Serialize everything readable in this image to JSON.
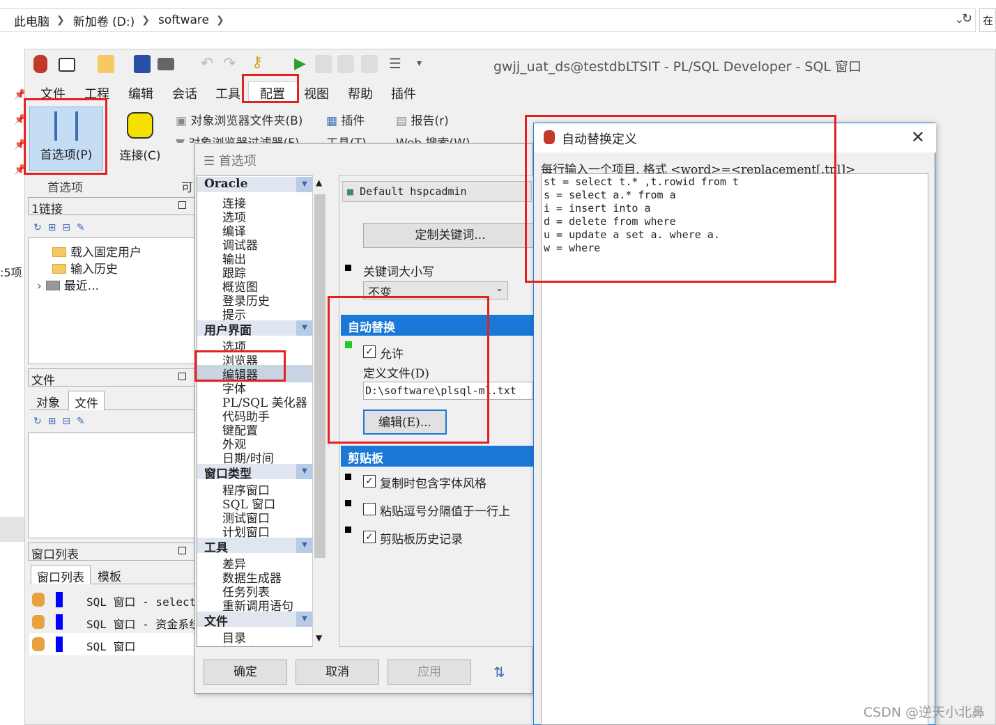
{
  "explorer": {
    "breadcrumb": [
      "此电脑",
      "新加卷 (D:)",
      "software"
    ],
    "side_label": "在",
    "left_label": ":5项"
  },
  "app": {
    "title": "gwjj_uat_ds@testdbLTSIT - PL/SQL Developer - SQL 窗口",
    "menu": [
      "文件",
      "工程",
      "编辑",
      "会话",
      "工具",
      "配置",
      "视图",
      "帮助",
      "插件"
    ],
    "active_menu": "配置",
    "ribbon": {
      "preferences": "首选项(P)",
      "connect": "连接(C)",
      "obj_browser_folders": "对象浏览器文件夹(B)",
      "obj_browser_filters": "对象浏览器过滤器(F)",
      "plugins": "插件",
      "reports": "报告(r)",
      "tools": "工具(T)",
      "web_search": "Web 搜索(W)",
      "group_prefs": "首选项",
      "group_other": "可"
    }
  },
  "left": {
    "conn_header": "1链接",
    "conn_items": [
      "载入固定用户",
      "输入历史",
      "最近..."
    ],
    "files_header": "文件",
    "files_tabs": [
      "对象",
      "文件"
    ],
    "winlist_header": "窗口列表",
    "winlist_tabs": [
      "窗口列表",
      "模板"
    ],
    "windows": [
      "SQL 窗口 - select",
      "SQL 窗口 - 资金系统",
      "SQL 窗口"
    ]
  },
  "prefs": {
    "title": "首选项",
    "nav": [
      {
        "group": "Oracle",
        "items": [
          "连接",
          "选项",
          "编译",
          "调试器",
          "输出",
          "跟踪",
          "概览图",
          "登录历史",
          "提示"
        ]
      },
      {
        "group": "用户界面",
        "items": [
          "选项",
          "浏览器",
          "编辑器",
          "字体",
          "PL/SQL 美化器",
          "代码助手",
          "键配置",
          "外观",
          "日期/时间"
        ]
      },
      {
        "group": "窗口类型",
        "items": [
          "程序窗口",
          "SQL 窗口",
          "测试窗口",
          "计划窗口"
        ]
      },
      {
        "group": "工具",
        "items": [
          "差异",
          "数据生成器",
          "任务列表",
          "重新调用语句"
        ]
      },
      {
        "group": "文件",
        "items": [
          "目录",
          "扩展名"
        ]
      }
    ],
    "selected_item": "编辑器",
    "profile": "Default hspcadmin",
    "define_keywords_btn": "定制关键词...",
    "keyword_case_label": "关键词大小写",
    "keyword_case_value": "不变",
    "autoreplace_header": "自动替换",
    "autoreplace_enabled_label": "允许",
    "autoreplace_enabled": true,
    "def_file_label": "定义文件(D)",
    "def_file_value": "D:\\software\\plsql-ml.txt",
    "edit_btn": "编辑(E)...",
    "clipboard_header": "剪贴板",
    "clip_opt1": "复制时包含字体风格",
    "clip_opt2": "粘贴逗号分隔值于一行上",
    "clip_opt3": "剪贴板历史记录",
    "ok": "确定",
    "cancel": "取消",
    "apply": "应用"
  },
  "autoreplace": {
    "title": "自动替换定义",
    "instruction": "每行输入一个项目, 格式 <word>=<replacement[.tpl]>",
    "lines": [
      "st = select t.* ,t.rowid from t",
      "s = select a.* from a",
      "i = insert into a",
      "d = delete from where",
      "u = update a set a. where a.",
      "w = where"
    ]
  },
  "watermark": "CSDN @逆天小北鼻",
  "colors": {
    "accent": "#1a78d7",
    "highlight": "#e52020",
    "green_indicator": "#22cc22"
  }
}
